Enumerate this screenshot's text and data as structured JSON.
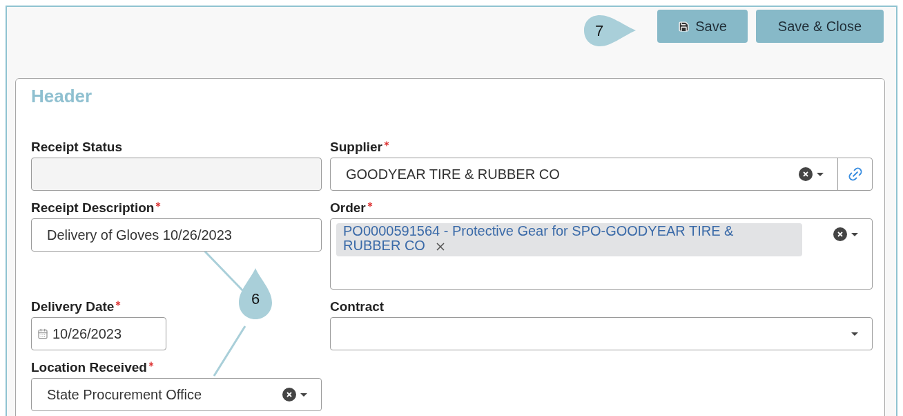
{
  "toolbar": {
    "buttons": [
      {
        "label": "Save",
        "kind": "save"
      },
      {
        "label": "Save & Close",
        "kind": "plain"
      }
    ]
  },
  "section": {
    "title": "Header",
    "fields": [
      {
        "label": "Receipt Status",
        "required": false,
        "kind": "readonly"
      },
      {
        "label": "Supplier",
        "required": true,
        "kind": "select",
        "value": "GOODYEAR TIRE & RUBBER CO",
        "clearable": true,
        "linked": true
      },
      {
        "label": "Receipt Description",
        "required": true,
        "kind": "text",
        "value": "Delivery of Gloves 10/26/2023"
      },
      {
        "label": "Order",
        "required": true,
        "kind": "multi",
        "tags": [
          "PO0000591564 - Protective Gear for SPO-GOODYEAR TIRE & RUBBER CO"
        ],
        "clearable": true
      },
      {
        "label": "Delivery Date",
        "required": true,
        "kind": "date",
        "value": "10/26/2023"
      },
      {
        "label": "Contract",
        "required": false,
        "kind": "select",
        "clearable": false,
        "linked": false
      },
      {
        "label": "Location Received",
        "required": true,
        "kind": "select",
        "value": "State Procurement Office",
        "clearable": true,
        "linked": false
      }
    ]
  },
  "callouts": [
    {
      "label": "7"
    },
    {
      "label": "6"
    }
  ]
}
